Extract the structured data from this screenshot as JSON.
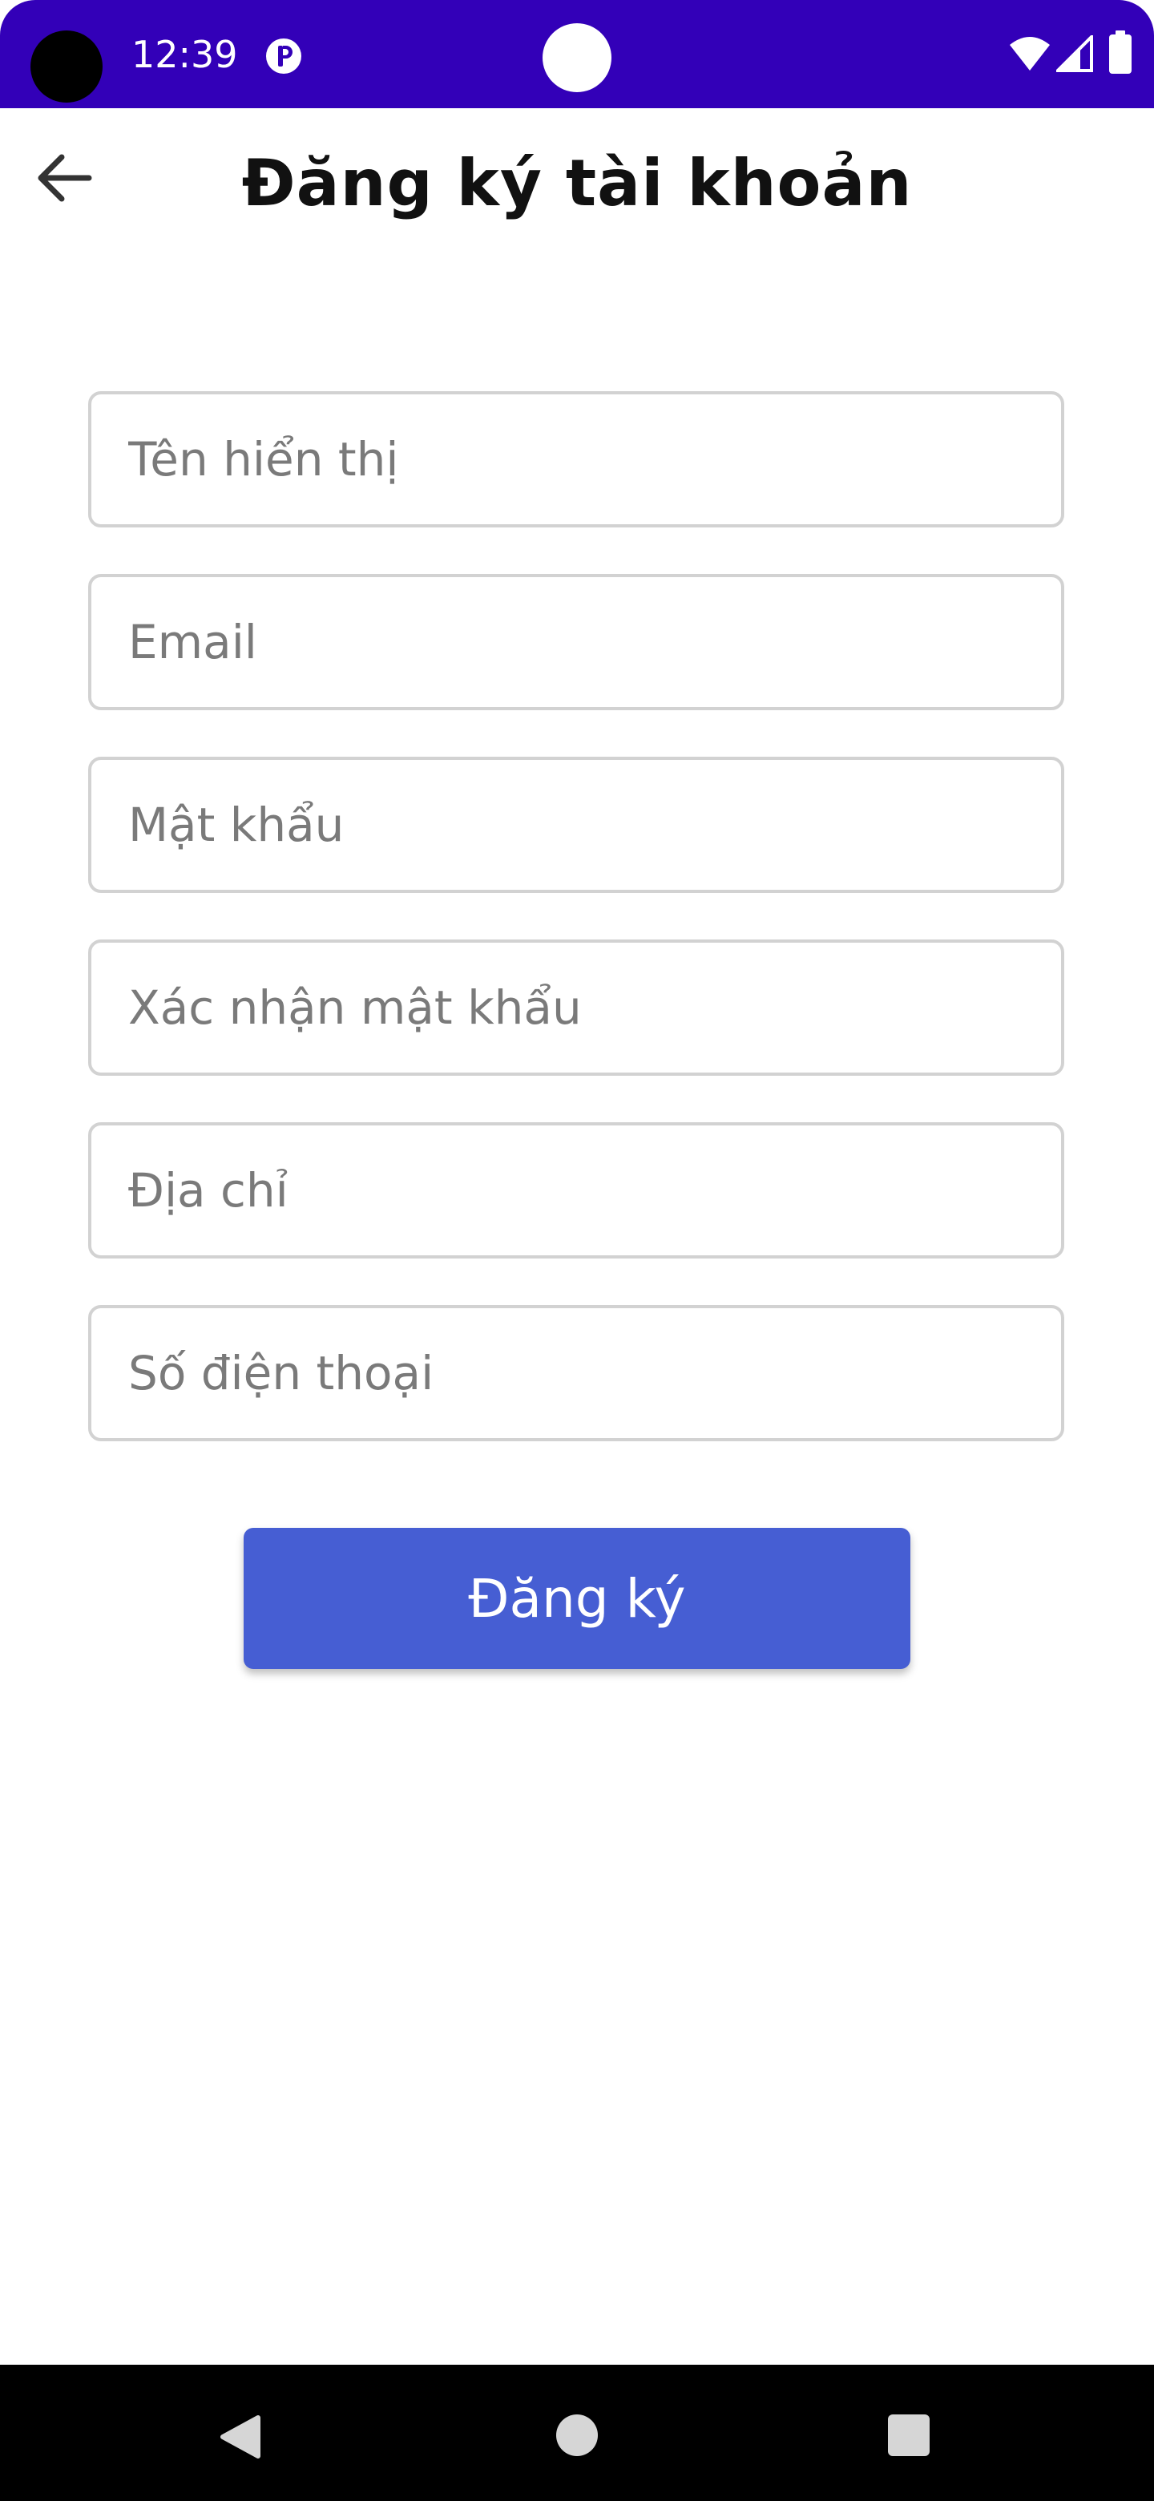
{
  "status_bar": {
    "time": "12:39",
    "icons": [
      "notification-p-icon",
      "wifi-icon",
      "signal-icon",
      "battery-icon"
    ],
    "background_color": "#3300b8"
  },
  "app_bar": {
    "title": "Đăng ký tài khoản",
    "back_icon": "arrow-left-icon"
  },
  "form": {
    "display_name": {
      "placeholder": "Tên hiển thị",
      "value": ""
    },
    "email": {
      "placeholder": "Email",
      "value": ""
    },
    "password": {
      "placeholder": "Mật khẩu",
      "value": ""
    },
    "confirm_password": {
      "placeholder": "Xác nhận mật khẩu",
      "value": ""
    },
    "address": {
      "placeholder": "Địa chỉ",
      "value": ""
    },
    "phone": {
      "placeholder": "Số điện thoại",
      "value": ""
    },
    "submit_label": "Đăng ký",
    "submit_color": "#465ed3"
  },
  "nav_bar": {
    "icons": [
      "nav-back-icon",
      "nav-home-icon",
      "nav-recents-icon"
    ]
  }
}
